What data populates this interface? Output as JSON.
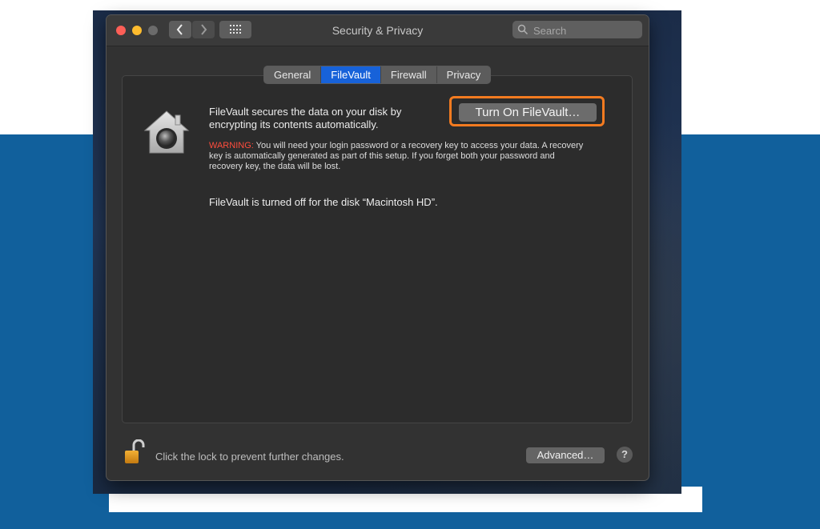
{
  "window": {
    "title": "Security & Privacy"
  },
  "toolbar": {
    "back_icon": "chevron-left-icon",
    "forward_icon": "chevron-right-icon",
    "show_all_icon": "grid-icon"
  },
  "search": {
    "placeholder": "Search",
    "value": ""
  },
  "tabs": [
    {
      "label": "General",
      "active": false
    },
    {
      "label": "FileVault",
      "active": true
    },
    {
      "label": "Firewall",
      "active": false
    },
    {
      "label": "Privacy",
      "active": false
    }
  ],
  "filevault": {
    "icon": "filevault-house-icon",
    "description": "FileVault secures the data on your disk by encrypting its contents automatically.",
    "turn_on_label": "Turn On FileVault…",
    "warning_label": "WARNING:",
    "warning_text": " You will need your login password or a recovery key to access your data. A recovery key is automatically generated as part of this setup. If you forget both your password and recovery key, the data will be lost.",
    "status": "FileVault is turned off for the disk “Macintosh HD”."
  },
  "footer": {
    "lock_icon": "unlocked-padlock-icon",
    "lock_text": "Click the lock to prevent further changes.",
    "advanced_label": "Advanced…",
    "help_label": "?"
  },
  "colors": {
    "window_bg": "#323232",
    "tab_active": "#1762d9",
    "highlight": "#f47b20",
    "warning": "#ff4d3d",
    "page_blue": "#11609c"
  }
}
